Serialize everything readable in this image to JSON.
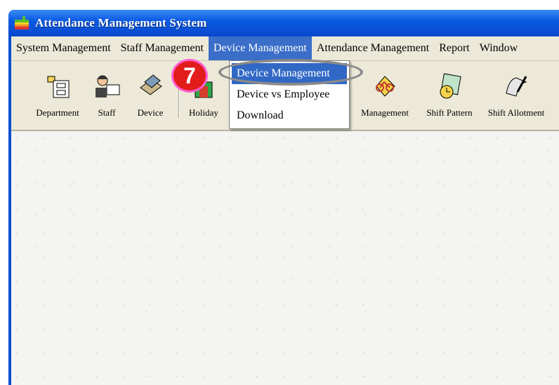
{
  "window": {
    "title": "Attendance Management System",
    "title_color": "#ffffff",
    "titlebar_color": "#0c5ae3"
  },
  "menubar": {
    "items": [
      {
        "label": "System Management"
      },
      {
        "label": "Staff Management"
      },
      {
        "label": "Device Management",
        "active": true
      },
      {
        "label": "Attendance Management"
      },
      {
        "label": "Report"
      },
      {
        "label": "Window"
      }
    ]
  },
  "toolbar": {
    "items": [
      {
        "label": "Department",
        "icon": "department-icon"
      },
      {
        "label": "Staff",
        "icon": "staff-icon"
      },
      {
        "label": "Device",
        "icon": "device-icon"
      },
      {
        "label": "Holiday",
        "icon": "holiday-icon"
      },
      {
        "label": "Management",
        "icon": "bicycle-icon"
      },
      {
        "label": "Shift Pattern",
        "icon": "shift-pattern-icon"
      },
      {
        "label": "Shift Allotment",
        "icon": "shift-allotment-icon"
      }
    ]
  },
  "dropdown": {
    "items": [
      {
        "label": "Device Management",
        "selected": true
      },
      {
        "label": "Device vs Employee"
      },
      {
        "label": "Download"
      }
    ],
    "highlight_color": "#3168c5"
  },
  "annotation": {
    "step_number": "7",
    "badge_color": "#e21b1b"
  }
}
